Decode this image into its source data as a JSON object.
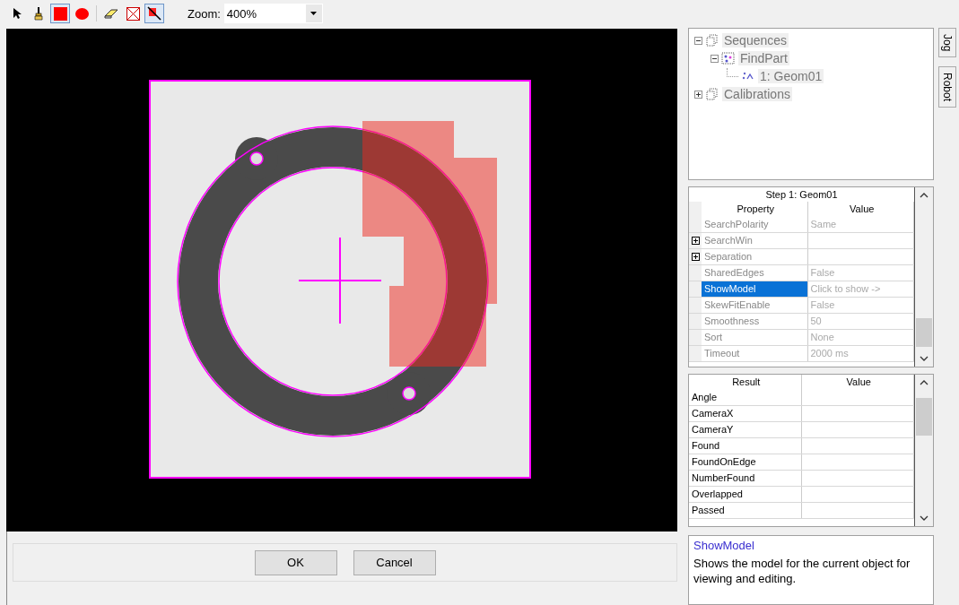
{
  "toolbar": {
    "tools": [
      {
        "kind": "pointer",
        "selected": false
      },
      {
        "kind": "brush",
        "selected": false
      },
      {
        "kind": "rectangle",
        "selected": true
      },
      {
        "kind": "ellipse",
        "selected": false
      },
      {
        "kind": "eraser",
        "selected": false
      },
      {
        "kind": "clear",
        "selected": false
      },
      {
        "kind": "dont-care",
        "selected": true
      }
    ],
    "zoom_label": "Zoom:",
    "zoom_value": "400%"
  },
  "image_view": {
    "search_window": true,
    "model_region": true,
    "crosshair": true
  },
  "tree": [
    {
      "label": "Sequences",
      "kind": "folder",
      "expanded": true,
      "children": [
        {
          "label": "FindPart",
          "kind": "sequence",
          "expanded": true,
          "children": [
            {
              "label": "1: Geom01",
              "kind": "step"
            }
          ]
        }
      ]
    },
    {
      "label": "Calibrations",
      "kind": "folder",
      "expanded": false
    }
  ],
  "side_tabs": [
    "Jog",
    "Robot"
  ],
  "properties": {
    "title": "Step 1: Geom01",
    "columns": [
      "Property",
      "Value"
    ],
    "rows": [
      {
        "name": "SearchPolarity",
        "value": "Same",
        "expandable": false,
        "selected": false
      },
      {
        "name": "SearchWin",
        "expandable": true,
        "selected": false
      },
      {
        "name": "Separation",
        "expandable": true,
        "selected": false
      },
      {
        "name": "SharedEdges",
        "value": "False",
        "expandable": false,
        "selected": false
      },
      {
        "name": "ShowModel",
        "value": "Click to show ->",
        "expandable": false,
        "selected": true
      },
      {
        "name": "SkewFitEnable",
        "value": "False",
        "expandable": false,
        "selected": false
      },
      {
        "name": "Smoothness",
        "value": "50",
        "expandable": false,
        "selected": false
      },
      {
        "name": "Sort",
        "value": "None",
        "expandable": false,
        "selected": false
      },
      {
        "name": "Timeout",
        "value": "2000 ms",
        "expandable": false,
        "selected": false
      }
    ]
  },
  "results": {
    "columns": [
      "Result",
      "Value"
    ],
    "rows": [
      "Angle",
      "CameraX",
      "CameraY",
      "Found",
      "FoundOnEdge",
      "NumberFound",
      "Overlapped",
      "Passed"
    ]
  },
  "help": {
    "title": "ShowModel",
    "text": "Shows the model for the current object for viewing and editing."
  },
  "buttons": [
    "OK",
    "Cancel"
  ]
}
